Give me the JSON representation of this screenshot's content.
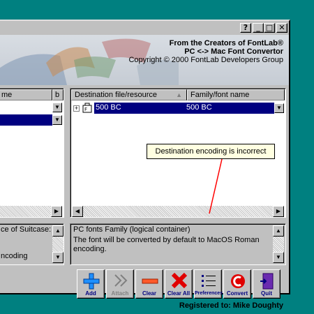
{
  "titlebar": {
    "help_label": "?",
    "minimize_label": "_",
    "maximize_label": "□",
    "close_label": "✕"
  },
  "banner": {
    "line1": "From the Creators of FontLab®",
    "line2": "PC <-> Mac Font Convertor",
    "line3": "Copyright © 2000 FontLab Developers Group"
  },
  "left_panel": {
    "header_name": "me",
    "header_b": "b",
    "info_line1": "ce of Suitcase:",
    "info_line2": "ncoding"
  },
  "right_panel": {
    "col1": "Destination file/resource",
    "col2": "Family/font name",
    "row": {
      "expander": "+",
      "resource": "500 BC",
      "family": "500 BC"
    }
  },
  "tooltip": "Destination encoding is incorrect",
  "message": {
    "line1": "PC fonts Family (logical container)",
    "line2": "The font will be converted by default to MacOS Roman encoding."
  },
  "toolbar": [
    {
      "label": "Add",
      "icon": "plus-icon"
    },
    {
      "label": "Attach",
      "icon": "attach-icon",
      "disabled": true
    },
    {
      "label": "Clear",
      "icon": "minus-icon"
    },
    {
      "label": "Clear All",
      "icon": "red-x-icon"
    },
    {
      "label": "Preferences",
      "icon": "preferences-icon"
    },
    {
      "label": "Convert",
      "icon": "convert-icon"
    },
    {
      "label": "Quit",
      "icon": "quit-door-icon"
    }
  ],
  "status": {
    "registered": "Registered to: Mike Doughty"
  },
  "colors": {
    "desktop": "#008080",
    "selection": "#000080",
    "tooltip_bg": "#ffffe1",
    "annotation": "#ff0000"
  }
}
